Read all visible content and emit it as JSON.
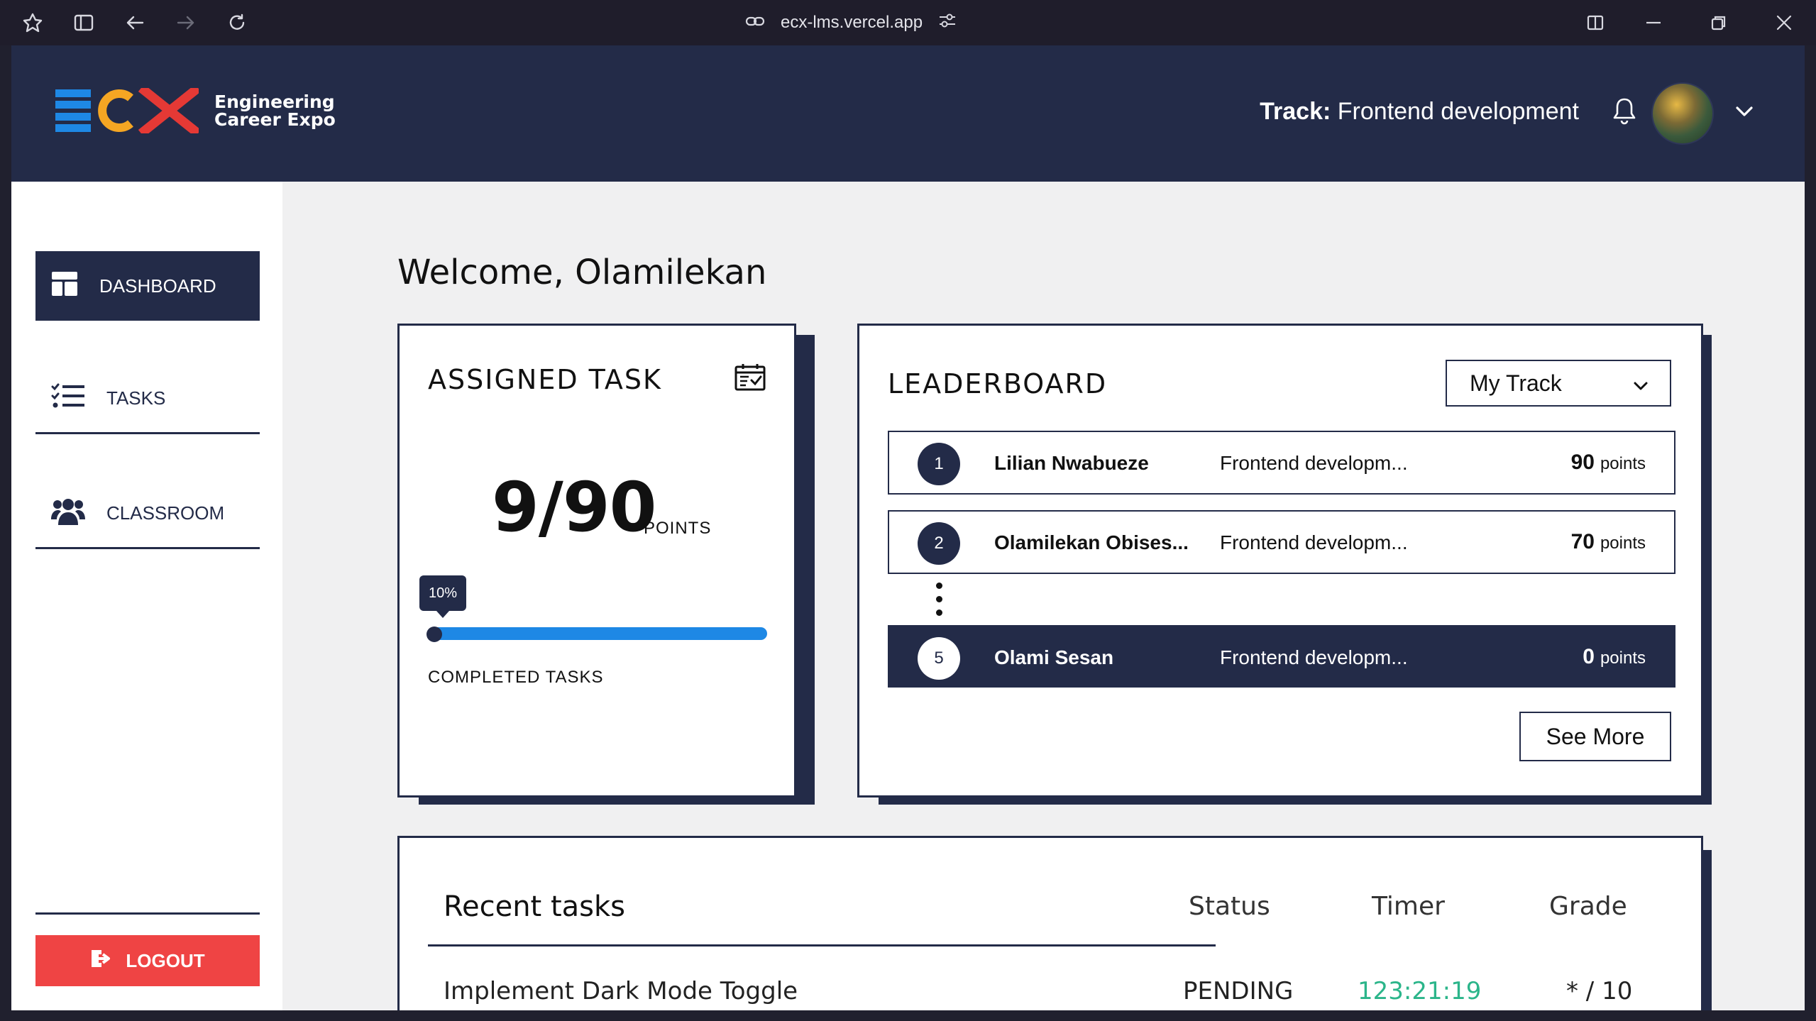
{
  "browser": {
    "url": "ecx-lms.vercel.app"
  },
  "header": {
    "logo_letters": "ECX",
    "logo_line1": "Engineering",
    "logo_line2": "Career Expo",
    "track_label": "Track:",
    "track_value": "Frontend development"
  },
  "sidebar": {
    "items": [
      {
        "label": "DASHBOARD"
      },
      {
        "label": "TASKS"
      },
      {
        "label": "CLASSROOM"
      }
    ],
    "logout_label": "LOGOUT"
  },
  "main": {
    "welcome": "Welcome, Olamilekan",
    "assigned": {
      "title": "ASSIGNED TASK",
      "score": "9/90",
      "points_unit": "POINTS",
      "progress_label": "10%",
      "progress_fraction": 0.1,
      "completed_label": "COMPLETED TASKS"
    },
    "leaderboard": {
      "title": "LEADERBOARD",
      "filter_value": "My Track",
      "rows": [
        {
          "rank": "1",
          "name": "Lilian Nwabueze",
          "track": "Frontend developm...",
          "points": "90",
          "unit": "points"
        },
        {
          "rank": "2",
          "name": "Olamilekan Obises...",
          "track": "Frontend developm...",
          "points": "70",
          "unit": "points"
        },
        {
          "rank": "5",
          "name": "Olami Sesan",
          "track": "Frontend developm...",
          "points": "0",
          "unit": "points"
        }
      ],
      "see_more": "See More"
    },
    "recent_tasks": {
      "title": "Recent tasks",
      "columns": {
        "status": "Status",
        "timer": "Timer",
        "grade": "Grade"
      },
      "rows": [
        {
          "name": "Implement Dark Mode Toggle",
          "status": "PENDING",
          "timer": "123:21:19",
          "grade": "* / 10"
        }
      ]
    }
  },
  "colors": {
    "navy": "#232b48",
    "logout_red": "#ef4444",
    "progress_blue": "#1e88e5",
    "timer_green": "#2bb58a",
    "logo_blue": "#1e88e5",
    "logo_orange": "#f5a623",
    "logo_red": "#e53935"
  }
}
